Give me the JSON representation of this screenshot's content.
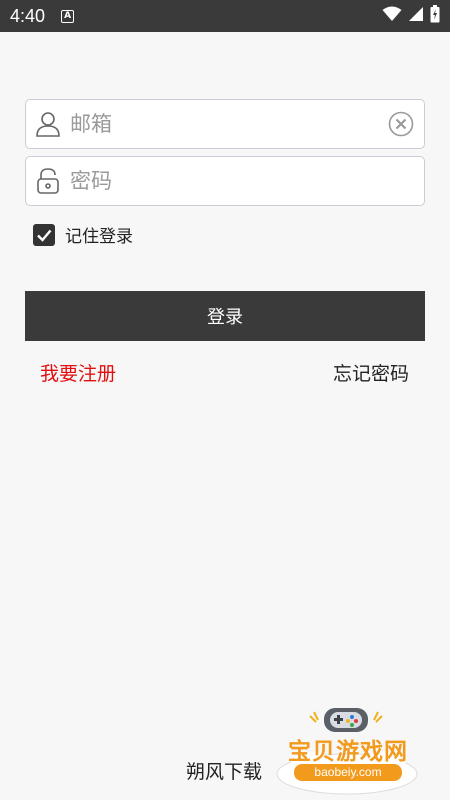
{
  "status_bar": {
    "time": "4:40",
    "notification_badge": "A"
  },
  "login_form": {
    "email_placeholder": "邮箱",
    "email_value": "",
    "password_placeholder": "密码",
    "password_value": "",
    "remember_label": "记住登录",
    "remember_checked": true,
    "login_button_label": "登录",
    "register_link": "我要注册",
    "forgot_password_link": "忘记密码"
  },
  "footer": {
    "brand": "朔风下载"
  },
  "watermark": {
    "title": "宝贝游戏网",
    "url": "baobeiy.com"
  },
  "colors": {
    "accent_dark": "#3a3a3a",
    "register_red": "#e11010",
    "watermark_orange": "#f29a1c"
  },
  "icons": [
    "user-icon",
    "lock-icon",
    "clear-icon",
    "checkmark-icon",
    "wifi-icon",
    "signal-icon",
    "battery-icon",
    "gamepad-icon"
  ]
}
